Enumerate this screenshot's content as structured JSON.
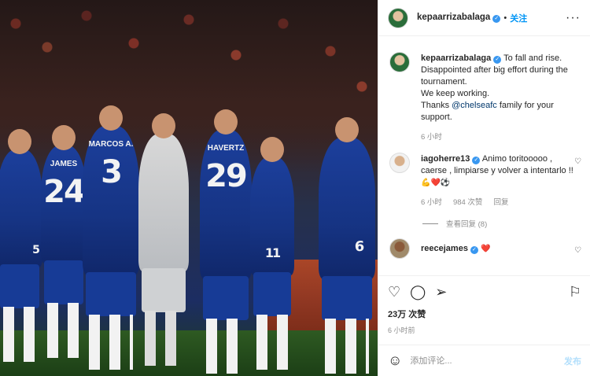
{
  "header": {
    "username": "kepaarrizabalaga",
    "follow_label": "关注",
    "more_label": "···"
  },
  "caption": {
    "username": "kepaarrizabalaga",
    "text_1": "To fall and rise. Disappointed after big effort during the tournament.",
    "text_2": "We keep working.",
    "text_3a": "Thanks ",
    "mention": "@chelseafc",
    "text_3b": " family for your support.",
    "time": "6 小时"
  },
  "comments": [
    {
      "username": "iagoherre13",
      "text": "Animo toritooooo , caerse , limpiarse y volver a intentarlo !! ",
      "emojis": "💪❤️⚽",
      "time": "6 小时",
      "likes": "984 次赞",
      "reply_label": "回复",
      "view_replies": "查看回复 (8)"
    },
    {
      "username": "reecejames",
      "emojis": "❤️"
    }
  ],
  "photo": {
    "players": [
      {
        "number": "5",
        "name": ""
      },
      {
        "number": "24",
        "name": "JAMES"
      },
      {
        "number": "3",
        "name": "MARCOS A."
      },
      {
        "number": "29",
        "name": "HAVERTZ"
      },
      {
        "number": "11",
        "name": ""
      },
      {
        "number": "6",
        "name": ""
      }
    ]
  },
  "actions": {
    "likes": "23万 次赞",
    "time": "6 小时前"
  },
  "add_comment": {
    "placeholder": "添加评论...",
    "post_label": "发布"
  },
  "icons": {
    "like": "heart-outline-icon",
    "comment": "comment-bubble-icon",
    "share": "paper-plane-icon",
    "save": "bookmark-icon",
    "emoji": "smiley-icon"
  },
  "colors": {
    "link": "#0095f6",
    "mention": "#00376b",
    "verified": "#3897f0",
    "heart": "#ed4956",
    "chelsea_blue": "#1c3f9c"
  }
}
